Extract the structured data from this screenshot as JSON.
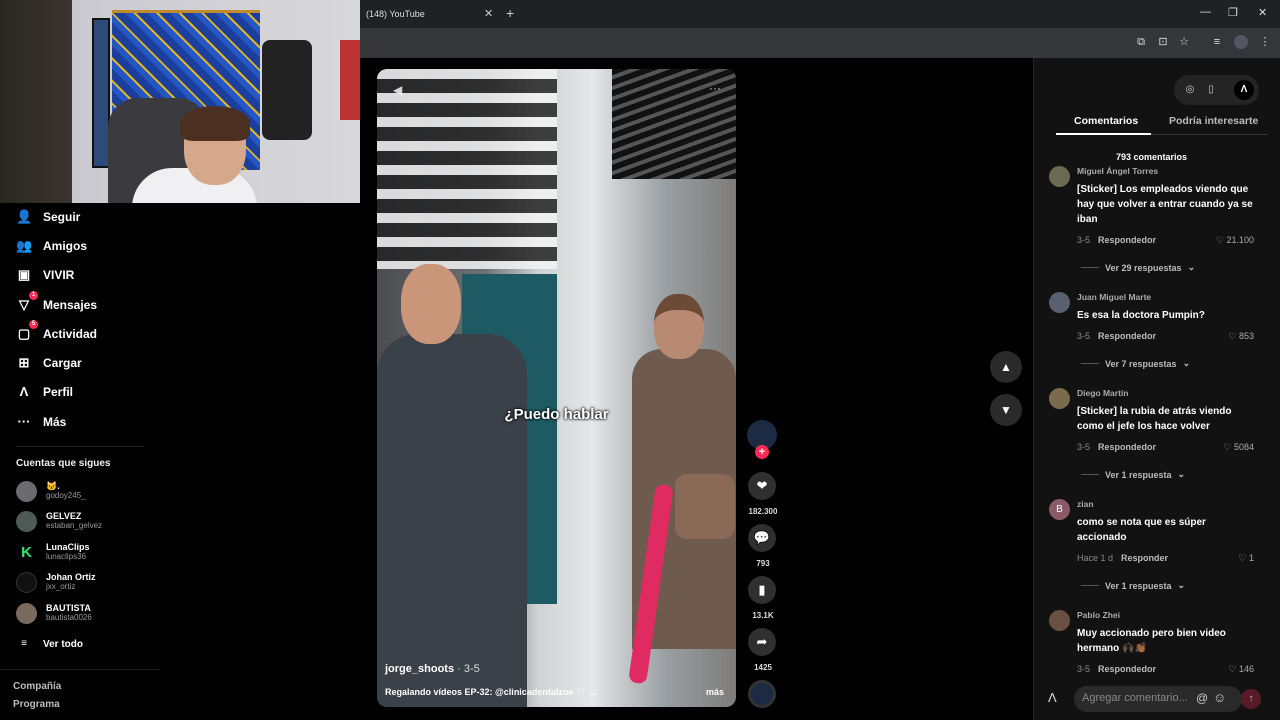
{
  "browser": {
    "tab_title": "(148) YouTube",
    "tab_close": "✕",
    "new_tab": "+",
    "window_controls": [
      "—",
      "❐",
      "✕"
    ]
  },
  "sidebar": {
    "nav": [
      {
        "label": "Seguir",
        "icon": "follow-user-icon",
        "glyph": "👤"
      },
      {
        "label": "Amigos",
        "icon": "friends-icon",
        "glyph": "👥"
      },
      {
        "label": "VIVIR",
        "icon": "live-icon",
        "glyph": "📺"
      },
      {
        "label": "Mensajes",
        "icon": "messages-icon",
        "glyph": "✉",
        "badge": "1"
      },
      {
        "label": "Actividad",
        "icon": "activity-icon",
        "glyph": "💬",
        "badge": "5"
      },
      {
        "label": "Cargar",
        "icon": "upload-icon",
        "glyph": "⊞"
      },
      {
        "label": "Perfil",
        "icon": "profile-icon",
        "glyph": "A"
      },
      {
        "label": "Más",
        "icon": "more-icon",
        "glyph": "···"
      }
    ],
    "following_title": "Cuentas que sigues",
    "accounts": [
      {
        "name": "🐱.",
        "user": "godoy245_"
      },
      {
        "name": "GELVEZ",
        "user": "estaban_gelvez"
      },
      {
        "name": "LunaClips",
        "user": "lunaclips36"
      },
      {
        "name": "Johan Ortiz",
        "user": "jxx_ortiz"
      },
      {
        "name": "BAUTISTA",
        "user": "bautista0026"
      }
    ],
    "see_all": "Ver todo",
    "footer_links": [
      "Compañía",
      "Programa"
    ]
  },
  "video": {
    "overlay_text": "¿Puedo hablar",
    "author": "jorge_shoots",
    "date": " · 3-5",
    "description": "Regalando vídeos EP-32: @clinicadentalzoe 🦷 ...",
    "more": "más"
  },
  "actions": {
    "likes": "182.300",
    "comments": "793",
    "saves": "13.1K",
    "shares": "1425",
    "follow_plus": "+"
  },
  "panel": {
    "tab_comments": "Comentarios",
    "tab_interest": "Podría interesarte",
    "comment_count": "793 comentarios",
    "comments": [
      {
        "user": "Miguel Ángel Torres",
        "text": "[Sticker] Los empleados viendo que hay que volver a entrar cuando ya se iban",
        "date": "3-5",
        "reply": "Respondedor",
        "likes": "21.100",
        "replies": "Ver 29 respuestas"
      },
      {
        "user": "Juan Miguel Marte",
        "text": "Es esa la doctora Pumpin?",
        "date": "3-5",
        "reply": "Respondedor",
        "likes": "853",
        "replies": "Ver 7 respuestas"
      },
      {
        "user": "Diego Martín",
        "text": "[Sticker] la rubia de atrás viendo como el jefe los hace volver",
        "date": "3-5",
        "reply": "Respondedor",
        "likes": "5084",
        "replies": "Ver 1 respuesta"
      },
      {
        "user": "zian",
        "avatar_letter": "B",
        "text": "como se nota que es súper accionado",
        "date": "Hace 1 d",
        "reply": "Responder",
        "likes": "1",
        "replies": "Ver 1 respuesta"
      },
      {
        "user": "Pablo Zhei",
        "text": "Muy accionado pero bien video hermano 🙌🏿👏🏾",
        "date": "3-5",
        "reply": "Respondedor",
        "likes": "146"
      }
    ],
    "composer_placeholder": "Agregar comentario...",
    "composer_at": "@",
    "composer_emoji": "☺",
    "composer_send": "↑"
  }
}
